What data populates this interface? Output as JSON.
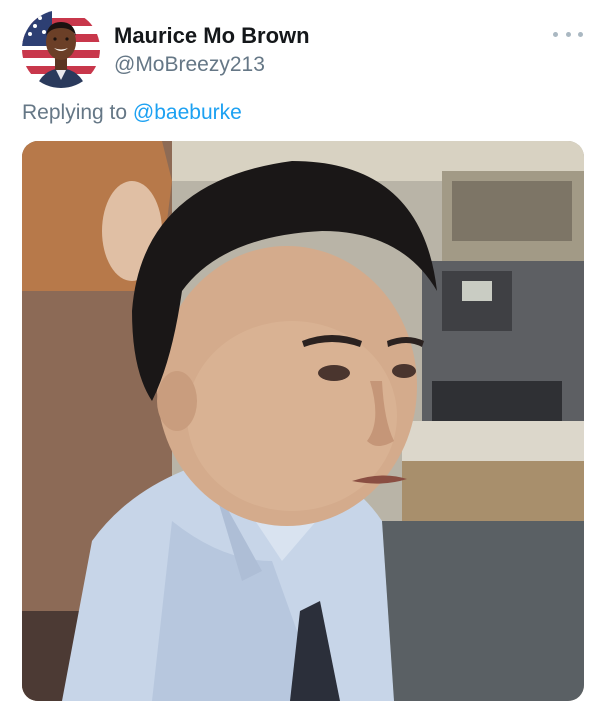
{
  "tweet": {
    "display_name": "Maurice Mo Brown",
    "handle": "@MoBreezy213",
    "reply_prefix": "Replying to",
    "reply_mention": "@baeburke",
    "more_icon": "more-horizontal-icon",
    "media_alt": "",
    "colors": {
      "name": "#14171a",
      "secondary": "#657786",
      "link": "#1da1f2"
    }
  }
}
